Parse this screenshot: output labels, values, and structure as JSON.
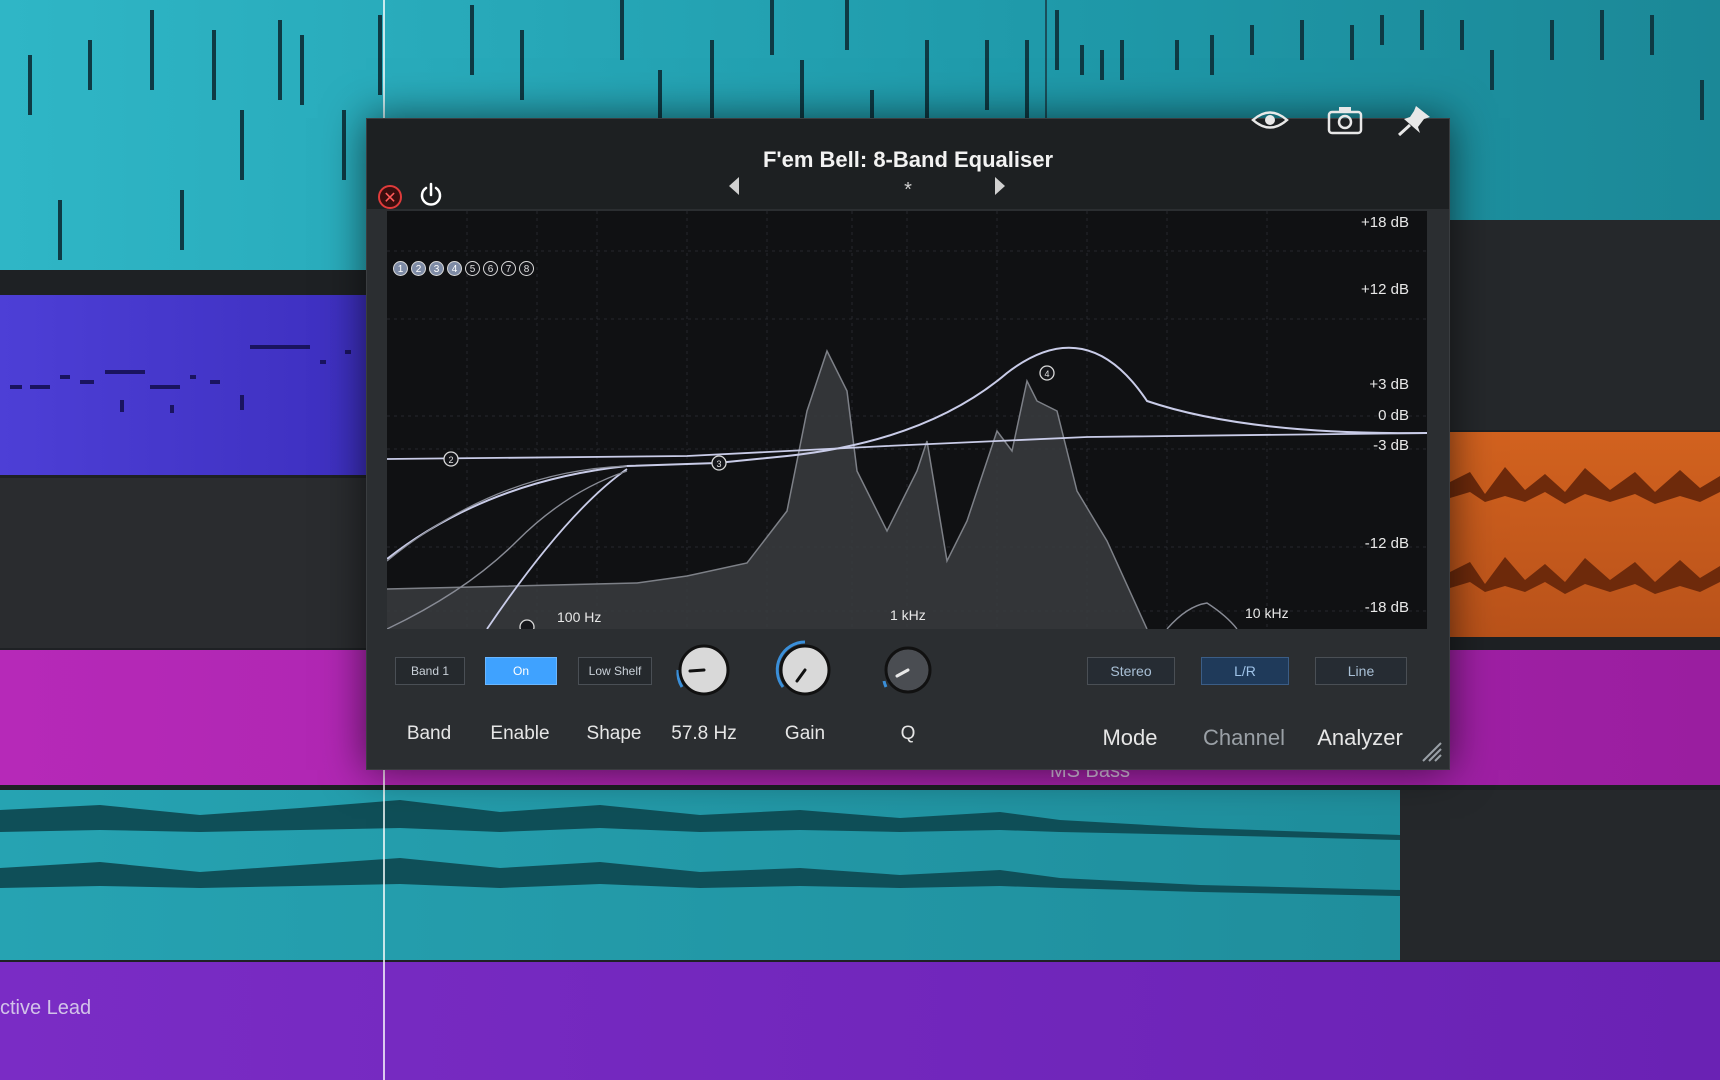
{
  "background": {
    "track_labels": {
      "ms_bass": "MS Bass",
      "lead": "ctive Lead"
    }
  },
  "plugin": {
    "title": "F'em Bell: 8-Band Equaliser",
    "preset_modified": "*",
    "header_icons": [
      "eye-icon",
      "camera-icon",
      "pin-icon"
    ],
    "bands": [
      "1",
      "2",
      "3",
      "4",
      "5",
      "6",
      "7",
      "8"
    ],
    "active_bands": [
      1,
      2,
      3,
      4
    ],
    "db_labels": [
      "+18 dB",
      "+12 dB",
      "+3 dB",
      "0 dB",
      "-3 dB",
      "-12 dB",
      "-18 dB"
    ],
    "hz_labels": [
      "100 Hz",
      "1 kHz",
      "10 kHz"
    ],
    "curve_nodes": [
      "2",
      "3",
      "4"
    ],
    "controls": {
      "band_value": "Band 1",
      "enable_value": "On",
      "shape_value": "Low Shelf",
      "freq_value": "57.8 Hz",
      "band_label": "Band",
      "enable_label": "Enable",
      "shape_label": "Shape",
      "gain_label": "Gain",
      "q_label": "Q",
      "mode_value": "Stereo",
      "channel_value": "L/R",
      "analyzer_value": "Line",
      "mode_label": "Mode",
      "channel_label": "Channel",
      "analyzer_label": "Analyzer"
    },
    "colors": {
      "enable_on": "#3fa2ff",
      "knob_arc": "#3a8fd9",
      "curve": "#c9cce8"
    }
  }
}
